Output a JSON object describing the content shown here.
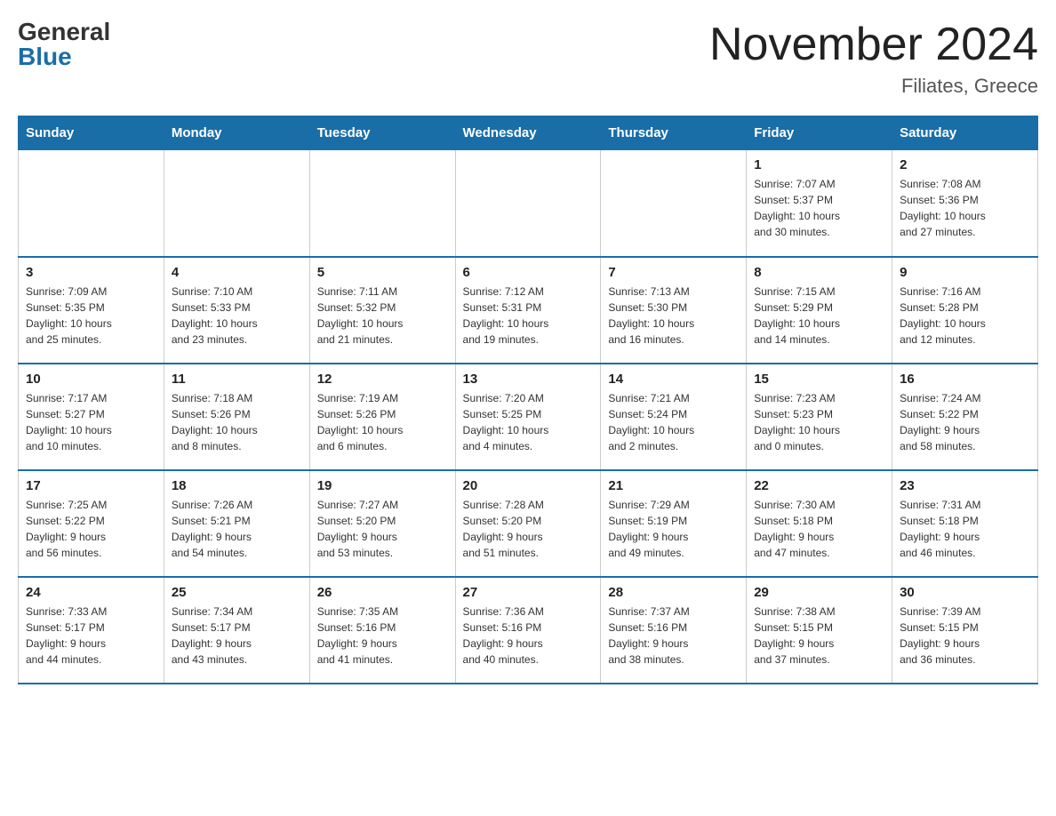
{
  "header": {
    "logo_general": "General",
    "logo_blue": "Blue",
    "month_title": "November 2024",
    "location": "Filiates, Greece"
  },
  "weekdays": [
    "Sunday",
    "Monday",
    "Tuesday",
    "Wednesday",
    "Thursday",
    "Friday",
    "Saturday"
  ],
  "weeks": [
    [
      {
        "day": "",
        "info": ""
      },
      {
        "day": "",
        "info": ""
      },
      {
        "day": "",
        "info": ""
      },
      {
        "day": "",
        "info": ""
      },
      {
        "day": "",
        "info": ""
      },
      {
        "day": "1",
        "info": "Sunrise: 7:07 AM\nSunset: 5:37 PM\nDaylight: 10 hours\nand 30 minutes."
      },
      {
        "day": "2",
        "info": "Sunrise: 7:08 AM\nSunset: 5:36 PM\nDaylight: 10 hours\nand 27 minutes."
      }
    ],
    [
      {
        "day": "3",
        "info": "Sunrise: 7:09 AM\nSunset: 5:35 PM\nDaylight: 10 hours\nand 25 minutes."
      },
      {
        "day": "4",
        "info": "Sunrise: 7:10 AM\nSunset: 5:33 PM\nDaylight: 10 hours\nand 23 minutes."
      },
      {
        "day": "5",
        "info": "Sunrise: 7:11 AM\nSunset: 5:32 PM\nDaylight: 10 hours\nand 21 minutes."
      },
      {
        "day": "6",
        "info": "Sunrise: 7:12 AM\nSunset: 5:31 PM\nDaylight: 10 hours\nand 19 minutes."
      },
      {
        "day": "7",
        "info": "Sunrise: 7:13 AM\nSunset: 5:30 PM\nDaylight: 10 hours\nand 16 minutes."
      },
      {
        "day": "8",
        "info": "Sunrise: 7:15 AM\nSunset: 5:29 PM\nDaylight: 10 hours\nand 14 minutes."
      },
      {
        "day": "9",
        "info": "Sunrise: 7:16 AM\nSunset: 5:28 PM\nDaylight: 10 hours\nand 12 minutes."
      }
    ],
    [
      {
        "day": "10",
        "info": "Sunrise: 7:17 AM\nSunset: 5:27 PM\nDaylight: 10 hours\nand 10 minutes."
      },
      {
        "day": "11",
        "info": "Sunrise: 7:18 AM\nSunset: 5:26 PM\nDaylight: 10 hours\nand 8 minutes."
      },
      {
        "day": "12",
        "info": "Sunrise: 7:19 AM\nSunset: 5:26 PM\nDaylight: 10 hours\nand 6 minutes."
      },
      {
        "day": "13",
        "info": "Sunrise: 7:20 AM\nSunset: 5:25 PM\nDaylight: 10 hours\nand 4 minutes."
      },
      {
        "day": "14",
        "info": "Sunrise: 7:21 AM\nSunset: 5:24 PM\nDaylight: 10 hours\nand 2 minutes."
      },
      {
        "day": "15",
        "info": "Sunrise: 7:23 AM\nSunset: 5:23 PM\nDaylight: 10 hours\nand 0 minutes."
      },
      {
        "day": "16",
        "info": "Sunrise: 7:24 AM\nSunset: 5:22 PM\nDaylight: 9 hours\nand 58 minutes."
      }
    ],
    [
      {
        "day": "17",
        "info": "Sunrise: 7:25 AM\nSunset: 5:22 PM\nDaylight: 9 hours\nand 56 minutes."
      },
      {
        "day": "18",
        "info": "Sunrise: 7:26 AM\nSunset: 5:21 PM\nDaylight: 9 hours\nand 54 minutes."
      },
      {
        "day": "19",
        "info": "Sunrise: 7:27 AM\nSunset: 5:20 PM\nDaylight: 9 hours\nand 53 minutes."
      },
      {
        "day": "20",
        "info": "Sunrise: 7:28 AM\nSunset: 5:20 PM\nDaylight: 9 hours\nand 51 minutes."
      },
      {
        "day": "21",
        "info": "Sunrise: 7:29 AM\nSunset: 5:19 PM\nDaylight: 9 hours\nand 49 minutes."
      },
      {
        "day": "22",
        "info": "Sunrise: 7:30 AM\nSunset: 5:18 PM\nDaylight: 9 hours\nand 47 minutes."
      },
      {
        "day": "23",
        "info": "Sunrise: 7:31 AM\nSunset: 5:18 PM\nDaylight: 9 hours\nand 46 minutes."
      }
    ],
    [
      {
        "day": "24",
        "info": "Sunrise: 7:33 AM\nSunset: 5:17 PM\nDaylight: 9 hours\nand 44 minutes."
      },
      {
        "day": "25",
        "info": "Sunrise: 7:34 AM\nSunset: 5:17 PM\nDaylight: 9 hours\nand 43 minutes."
      },
      {
        "day": "26",
        "info": "Sunrise: 7:35 AM\nSunset: 5:16 PM\nDaylight: 9 hours\nand 41 minutes."
      },
      {
        "day": "27",
        "info": "Sunrise: 7:36 AM\nSunset: 5:16 PM\nDaylight: 9 hours\nand 40 minutes."
      },
      {
        "day": "28",
        "info": "Sunrise: 7:37 AM\nSunset: 5:16 PM\nDaylight: 9 hours\nand 38 minutes."
      },
      {
        "day": "29",
        "info": "Sunrise: 7:38 AM\nSunset: 5:15 PM\nDaylight: 9 hours\nand 37 minutes."
      },
      {
        "day": "30",
        "info": "Sunrise: 7:39 AM\nSunset: 5:15 PM\nDaylight: 9 hours\nand 36 minutes."
      }
    ]
  ]
}
